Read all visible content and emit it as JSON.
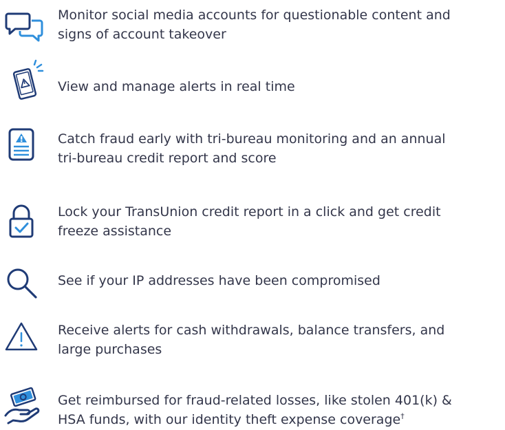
{
  "colors": {
    "text": "#33364a",
    "icon": "#1f3b76",
    "accent": "#2f8fdc"
  },
  "features": [
    {
      "icon": "chat-bubbles-icon",
      "lines": [
        "Monitor social media accounts for questionable content and",
        "signs of account takeover"
      ]
    },
    {
      "icon": "phone-alert-icon",
      "lines": [
        "View and manage alerts in real time"
      ]
    },
    {
      "icon": "credit-report-icon",
      "lines": [
        "Catch fraud early with tri-bureau monitoring and an annual",
        "tri-bureau credit report and score"
      ]
    },
    {
      "icon": "lock-check-icon",
      "lines": [
        "Lock your TransUnion credit report in a click and get credit",
        "freeze assistance"
      ]
    },
    {
      "icon": "magnifier-icon",
      "lines": [
        "See if your IP addresses have been compromised"
      ]
    },
    {
      "icon": "warning-triangle-icon",
      "lines": [
        "Receive alerts for cash withdrawals, balance transfers, and",
        "large purchases"
      ]
    },
    {
      "icon": "money-hand-icon",
      "lines": [
        "Get reimbursed for fraud-related losses, like stolen 401(k) &",
        "HSA funds, with our identity theft expense coverage"
      ],
      "footnote_mark": "†"
    }
  ]
}
